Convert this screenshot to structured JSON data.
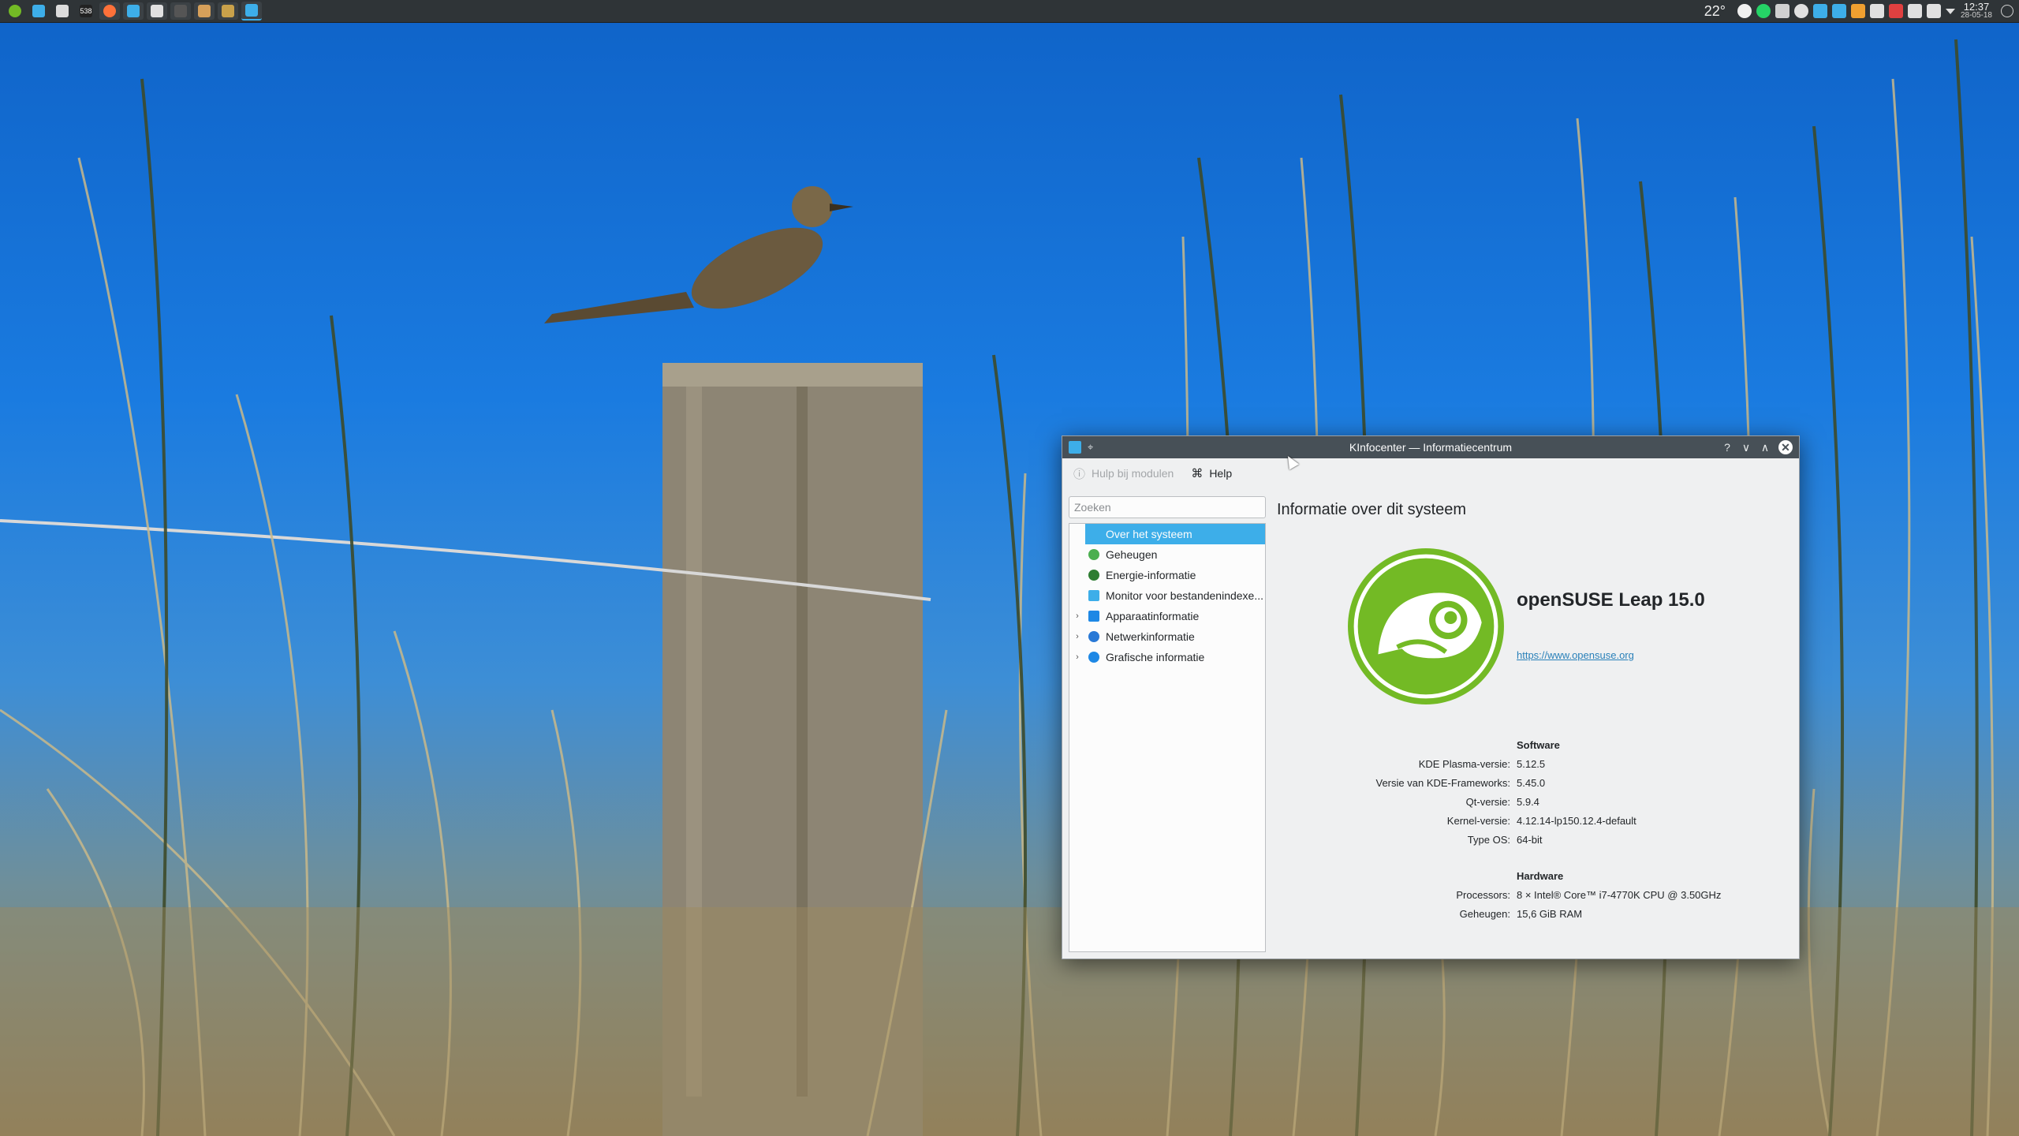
{
  "panel": {
    "launchers": [
      {
        "icon": "opensuse-menu-icon",
        "color": "#73ba25"
      },
      {
        "icon": "desktop-icon",
        "color": "#3daee9"
      },
      {
        "icon": "system-monitor-icon",
        "color": "#dcdcdc"
      },
      {
        "icon": "calendar-icon",
        "color": "#222222"
      },
      {
        "icon": "firefox-icon",
        "color": "#ff7139"
      },
      {
        "icon": "file-manager-icon",
        "color": "#3daee9"
      },
      {
        "icon": "settings-icon",
        "color": "#e0e0e0"
      },
      {
        "icon": "terminal-icon",
        "color": "#555555"
      },
      {
        "icon": "archive-icon",
        "color": "#d6a05a"
      },
      {
        "icon": "image-viewer-icon",
        "color": "#c9a14a"
      },
      {
        "icon": "kinfocenter-icon",
        "color": "#3daee9"
      }
    ],
    "calendar_badge": "538",
    "temperature": "22°",
    "tray": [
      {
        "icon": "weather-sun-icon",
        "color": "#f0f0f0"
      },
      {
        "icon": "whatsapp-icon",
        "color": "#25d366"
      },
      {
        "icon": "battery-icon",
        "color": "#d0d0d0"
      },
      {
        "icon": "steam-icon",
        "color": "#e0e0e0"
      },
      {
        "icon": "dropbox-icon",
        "color": "#3daee9"
      },
      {
        "icon": "kde-connect-icon",
        "color": "#3daee9"
      },
      {
        "icon": "night-color-icon",
        "color": "#f0a030"
      },
      {
        "icon": "network-icon",
        "color": "#e0e0e0"
      },
      {
        "icon": "updates-icon",
        "color": "#e04040"
      },
      {
        "icon": "display-icon",
        "color": "#e0e0e0"
      },
      {
        "icon": "volume-icon",
        "color": "#e0e0e0"
      },
      {
        "icon": "expand-tray-icon",
        "color": "#e0e0e0"
      }
    ],
    "clock_time": "12:37",
    "clock_date": "28-05-18"
  },
  "window": {
    "title": "KInfocenter — Informatiecentrum",
    "toolbar": {
      "module_help": "Hulp bij modulen",
      "help": "Help"
    },
    "search_placeholder": "Zoeken",
    "nav": [
      {
        "label": "Over het systeem",
        "icon": "info-icon",
        "color": "#3daee9",
        "selected": true,
        "expandable": false
      },
      {
        "label": "Geheugen",
        "icon": "memory-icon",
        "color": "#4caf50",
        "selected": false,
        "expandable": false
      },
      {
        "label": "Energie-informatie",
        "icon": "energy-icon",
        "color": "#2e7d32",
        "selected": false,
        "expandable": false
      },
      {
        "label": "Monitor voor bestandenindexe...",
        "icon": "file-index-icon",
        "color": "#3daee9",
        "selected": false,
        "expandable": false
      },
      {
        "label": "Apparaatinformatie",
        "icon": "device-icon",
        "color": "#1e88e5",
        "selected": false,
        "expandable": true
      },
      {
        "label": "Netwerkinformatie",
        "icon": "network-icon",
        "color": "#2979d6",
        "selected": false,
        "expandable": true
      },
      {
        "label": "Grafische informatie",
        "icon": "graphics-icon",
        "color": "#1e88e5",
        "selected": false,
        "expandable": true
      }
    ],
    "content": {
      "heading": "Informatie over dit systeem",
      "distro_name": "openSUSE Leap 15.0",
      "distro_url": "https://www.opensuse.org",
      "logo_color": "#73ba25",
      "software_title": "Software",
      "software": [
        {
          "key": "KDE Plasma-versie:",
          "value": "5.12.5"
        },
        {
          "key": "Versie van KDE-Frameworks:",
          "value": "5.45.0"
        },
        {
          "key": "Qt-versie:",
          "value": "5.9.4"
        },
        {
          "key": "Kernel-versie:",
          "value": "4.12.14-lp150.12.4-default"
        },
        {
          "key": "Type OS:",
          "value": "64-bit"
        }
      ],
      "hardware_title": "Hardware",
      "hardware": [
        {
          "key": "Processors:",
          "value": "8 × Intel® Core™ i7-4770K CPU @ 3.50GHz"
        },
        {
          "key": "Geheugen:",
          "value": "15,6 GiB RAM"
        }
      ]
    }
  }
}
